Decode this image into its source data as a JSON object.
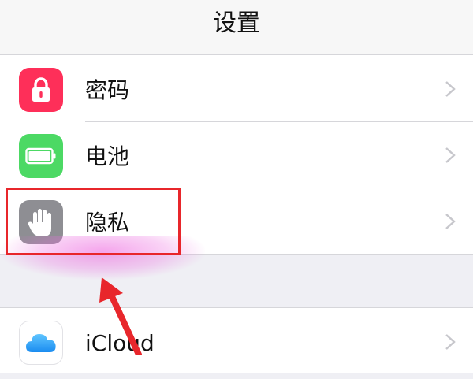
{
  "header": {
    "title": "设置"
  },
  "settings": {
    "items": [
      {
        "label": "密码",
        "icon": "lock-icon",
        "color": "#fe2f59"
      },
      {
        "label": "电池",
        "icon": "battery-icon",
        "color": "#4cd964"
      },
      {
        "label": "隐私",
        "icon": "hand-icon",
        "color": "#8e8e93"
      }
    ],
    "icloud": {
      "label": "iCloud",
      "icon": "icloud-icon"
    }
  },
  "annotation": {
    "highlight_color": "#e8262b",
    "arrow_color": "#e8262b"
  }
}
